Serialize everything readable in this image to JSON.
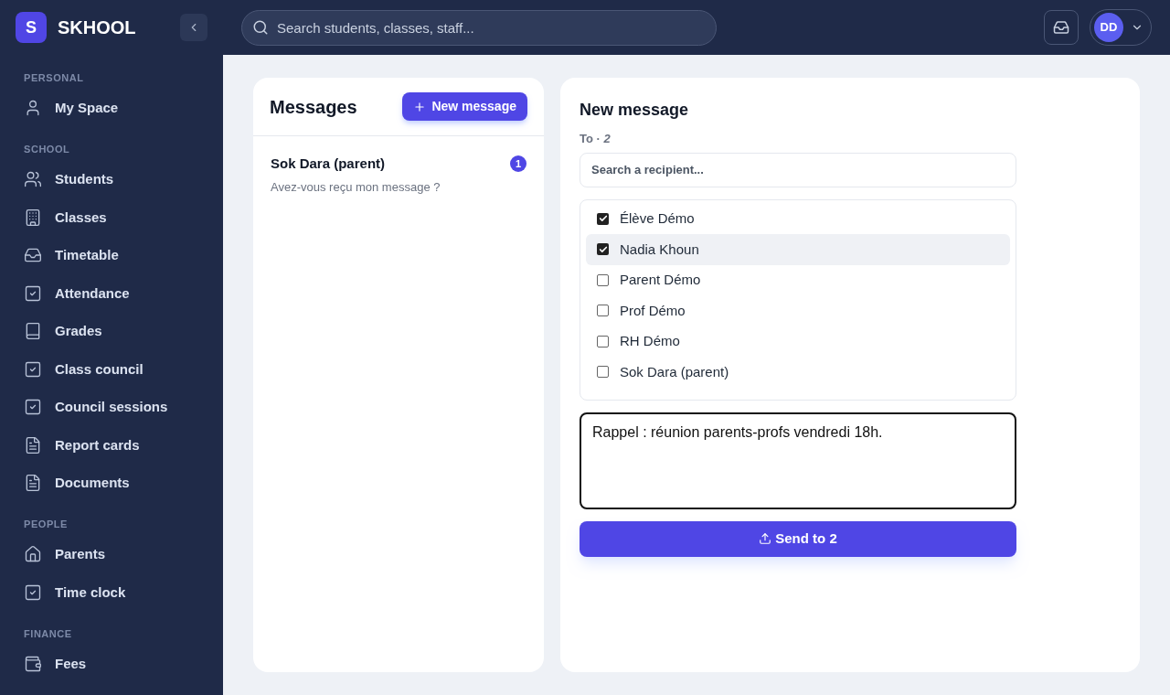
{
  "brand": {
    "logo": "S",
    "name": "SKHOOL"
  },
  "sidebar": {
    "sections": [
      {
        "title": "PERSONAL",
        "items": [
          {
            "label": "My Space",
            "kind": "user"
          }
        ]
      },
      {
        "title": "SCHOOL",
        "items": [
          {
            "label": "Students",
            "kind": "users"
          },
          {
            "label": "Classes",
            "kind": "building"
          },
          {
            "label": "Timetable",
            "kind": "inbox"
          },
          {
            "label": "Attendance",
            "kind": "check"
          },
          {
            "label": "Grades",
            "kind": "book"
          },
          {
            "label": "Class council",
            "kind": "check"
          },
          {
            "label": "Council sessions",
            "kind": "check"
          },
          {
            "label": "Report cards",
            "kind": "file"
          },
          {
            "label": "Documents",
            "kind": "file"
          }
        ]
      },
      {
        "title": "PEOPLE",
        "items": [
          {
            "label": "Parents",
            "kind": "home"
          },
          {
            "label": "Time clock",
            "kind": "check"
          }
        ]
      },
      {
        "title": "FINANCE",
        "items": [
          {
            "label": "Fees",
            "kind": "wallet"
          }
        ]
      }
    ]
  },
  "search": {
    "placeholder": "Search students, classes, staff..."
  },
  "user": {
    "initials": "DD"
  },
  "messages": {
    "title": "Messages",
    "new_button": "New message",
    "threads": [
      {
        "name": "Sok Dara (parent)",
        "preview": "Avez-vous reçu mon message ?",
        "unread": "1"
      }
    ]
  },
  "compose": {
    "title": "New message",
    "to_label": "To",
    "to_separator": "·",
    "to_count": "2",
    "recipient_placeholder": "Search a recipient...",
    "recipients": [
      {
        "name": "Élève Démo",
        "checked": true,
        "selected": false
      },
      {
        "name": "Nadia Khoun",
        "checked": true,
        "selected": true
      },
      {
        "name": "Parent Démo",
        "checked": false,
        "selected": false
      },
      {
        "name": "Prof Démo",
        "checked": false,
        "selected": false
      },
      {
        "name": "RH Démo",
        "checked": false,
        "selected": false
      },
      {
        "name": "Sok Dara (parent)",
        "checked": false,
        "selected": false
      }
    ],
    "body": "Rappel : réunion parents-profs vendredi 18h.",
    "send_button": "Send to 2"
  }
}
